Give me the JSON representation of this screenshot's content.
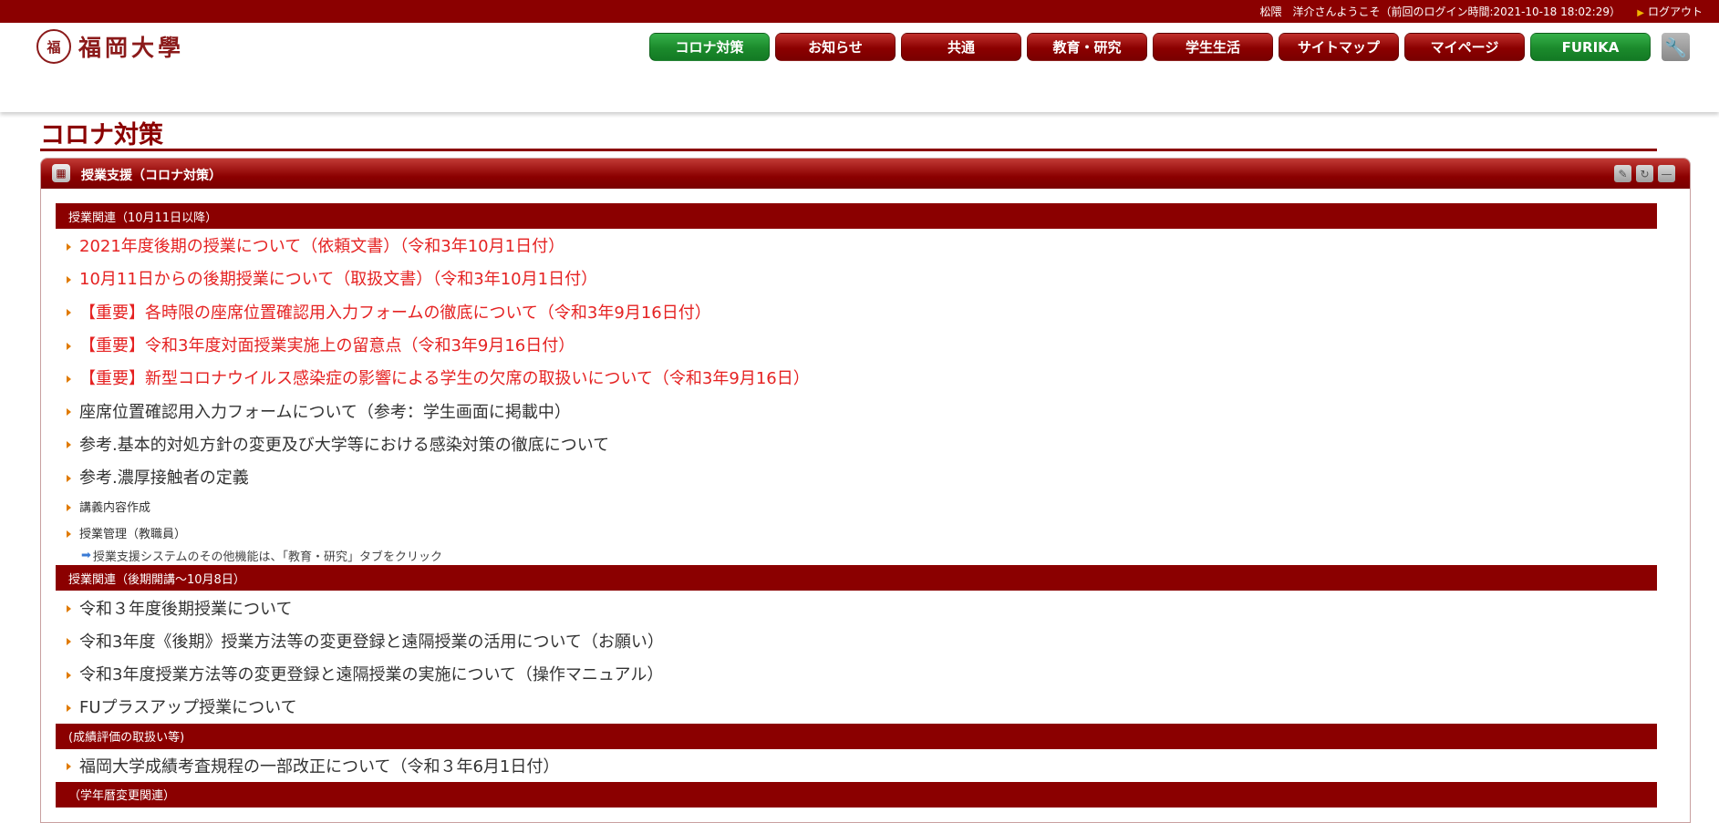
{
  "topbar": {
    "welcome": "松隈　洋介さんようこそ（前回のログイン時間:2021-10-18 18:02:29）",
    "logout": "ログアウト"
  },
  "logo": {
    "seal": "福",
    "name": "福岡大學"
  },
  "nav": {
    "items": [
      "コロナ対策",
      "お知らせ",
      "共通",
      "教育・研究",
      "学生生活",
      "サイトマップ",
      "マイページ",
      "FURIKA"
    ],
    "tool_icon": "wrench-icon"
  },
  "page": {
    "title": "コロナ対策"
  },
  "panel": {
    "title": "授業支援（コロナ対策）",
    "icon": "portlet-icon",
    "tools": [
      "wrench-icon",
      "refresh-icon",
      "minimize-icon"
    ]
  },
  "sections": [
    {
      "title": "授業関連（10月11日以降）",
      "items": [
        "2021年度後期の授業について（依頼文書）（令和3年10月1日付）",
        "10月11日からの後期授業について（取扱文書）（令和3年10月1日付）",
        "【重要】各時限の座席位置確認用入力フォームの徹底について（令和3年9月16日付）",
        "【重要】令和3年度対面授業実施上の留意点（令和3年9月16日付）",
        "【重要】新型コロナウイルス感染症の影響による学生の欠席の取扱いについて（令和3年9月16日）",
        "座席位置確認用入力フォームについて（参考：学生画面に掲載中）",
        "参考.基本的対処方針の変更及び大学等における感染対策の徹底について",
        "参考.濃厚接触者の定義",
        "講義内容作成",
        "授業管理（教職員）"
      ],
      "note": "授業支援システムのその他機能は、「教育・研究」タブをクリック"
    },
    {
      "title": "授業関連（後期開講～10月8日）",
      "items": [
        "令和３年度後期授業について",
        "令和3年度《後期》授業方法等の変更登録と遠隔授業の活用について（お願い）",
        "令和3年度授業方法等の変更登録と遠隔授業の実施について（操作マニュアル）",
        "FUプラスアップ授業について"
      ]
    },
    {
      "title": "(成績評価の取扱い等)",
      "items": [
        "福岡大学成績考査規程の一部改正について（令和３年6月1日付）"
      ]
    },
    {
      "title": "（学年暦変更関連）",
      "items": []
    }
  ],
  "colors": {
    "brand": "#8b0000",
    "green": "#1b8a2c",
    "alert_link": "#e52222",
    "bullet": "#e07a00"
  }
}
